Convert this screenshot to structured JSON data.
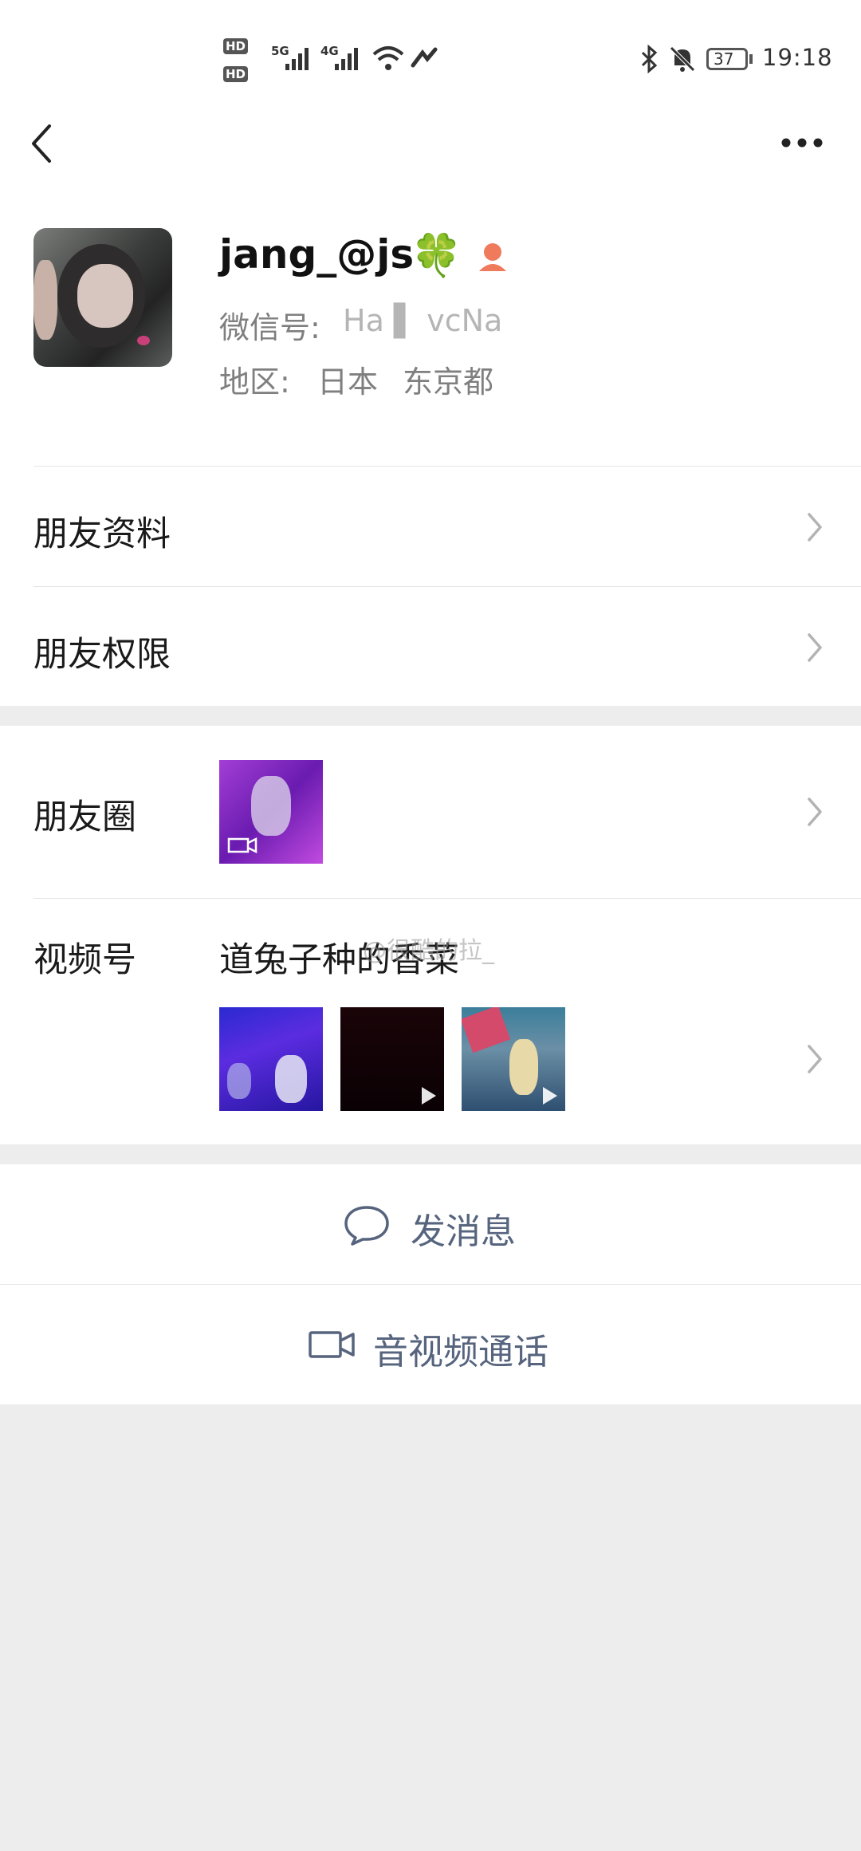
{
  "status_bar": {
    "network_5g": "5G",
    "network_4g": "4G",
    "hd1": "HD",
    "hd2": "HD",
    "battery": "37",
    "time": "19:18"
  },
  "header": {
    "back_icon": "chevron-left-icon",
    "more_icon": "more-horizontal-icon"
  },
  "profile": {
    "name": "jang_@js",
    "wechat_id_label": "微信号:",
    "wechat_id_value": "Ha ▌ vcNa",
    "region_label": "地区:",
    "region_country": "日本",
    "region_city": "东京都",
    "name_emoji": "🍀",
    "gender_icon": "female-icon"
  },
  "menu": {
    "friend_info": "朋友资料",
    "friend_permissions": "朋友权限",
    "moments": "朋友圈",
    "channels": "视频号",
    "channels_title": "道兔子种的香菜",
    "watermark": "@很酷的拉_"
  },
  "actions": {
    "send_message": "发消息",
    "video_call": "音视频通话"
  },
  "colors": {
    "accent_text": "#56647e",
    "background": "#ededed",
    "card": "#ffffff"
  }
}
